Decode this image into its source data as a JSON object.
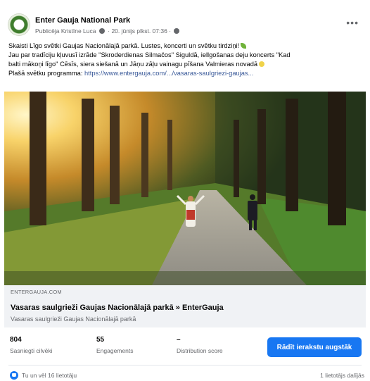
{
  "post": {
    "page_name": "Enter Gauja National Park",
    "meta": "Publicēja Kristīne Luca",
    "date": "20. jūnijs plkst. 07:36",
    "more_icon": "more-options-icon",
    "text_lines": [
      "Skaisti Līgo svētki Gaujas Nacionālajā parkā. Lustes, koncerti un svētku tirdziņi!",
      "Jau par tradīciju kļuvusī izrāde \"Skroderdienas Silmačos\" Siguldā, iellgošanas deju koncerts \"Kad",
      "balti mākoņi līgo\" Cēsīs, siera siešanā un Jāņu zāļu vainagu pīšana Valmieras novadā"
    ],
    "program_label": "Plašā svētku programma:",
    "program_link": "https://www.entergauja.com/.../vasaras-saulgriezi-gaujas..."
  },
  "link_preview": {
    "domain": "ENTERGAUJA.COM",
    "title": "Vasaras saulgrieži Gaujas Nacionālajā parkā » EnterGauja",
    "description": "Vasaras saulgrieži Gaujas Nacionālajā parkā"
  },
  "stats": {
    "reached_value": "804",
    "reached_label": "Sasniegti cilvēki",
    "engagements_value": "55",
    "engagements_label": "Engagements",
    "distribution_value": "–",
    "distribution_label": "Distribution score",
    "boost_label": "Rādīt ierakstu augstāk"
  },
  "footer": {
    "reactions": "Tu un vēl 16 lietotāju",
    "shares": "1 lietotājs dalījās"
  },
  "colors": {
    "accent": "#1877f2",
    "link": "#385898"
  }
}
